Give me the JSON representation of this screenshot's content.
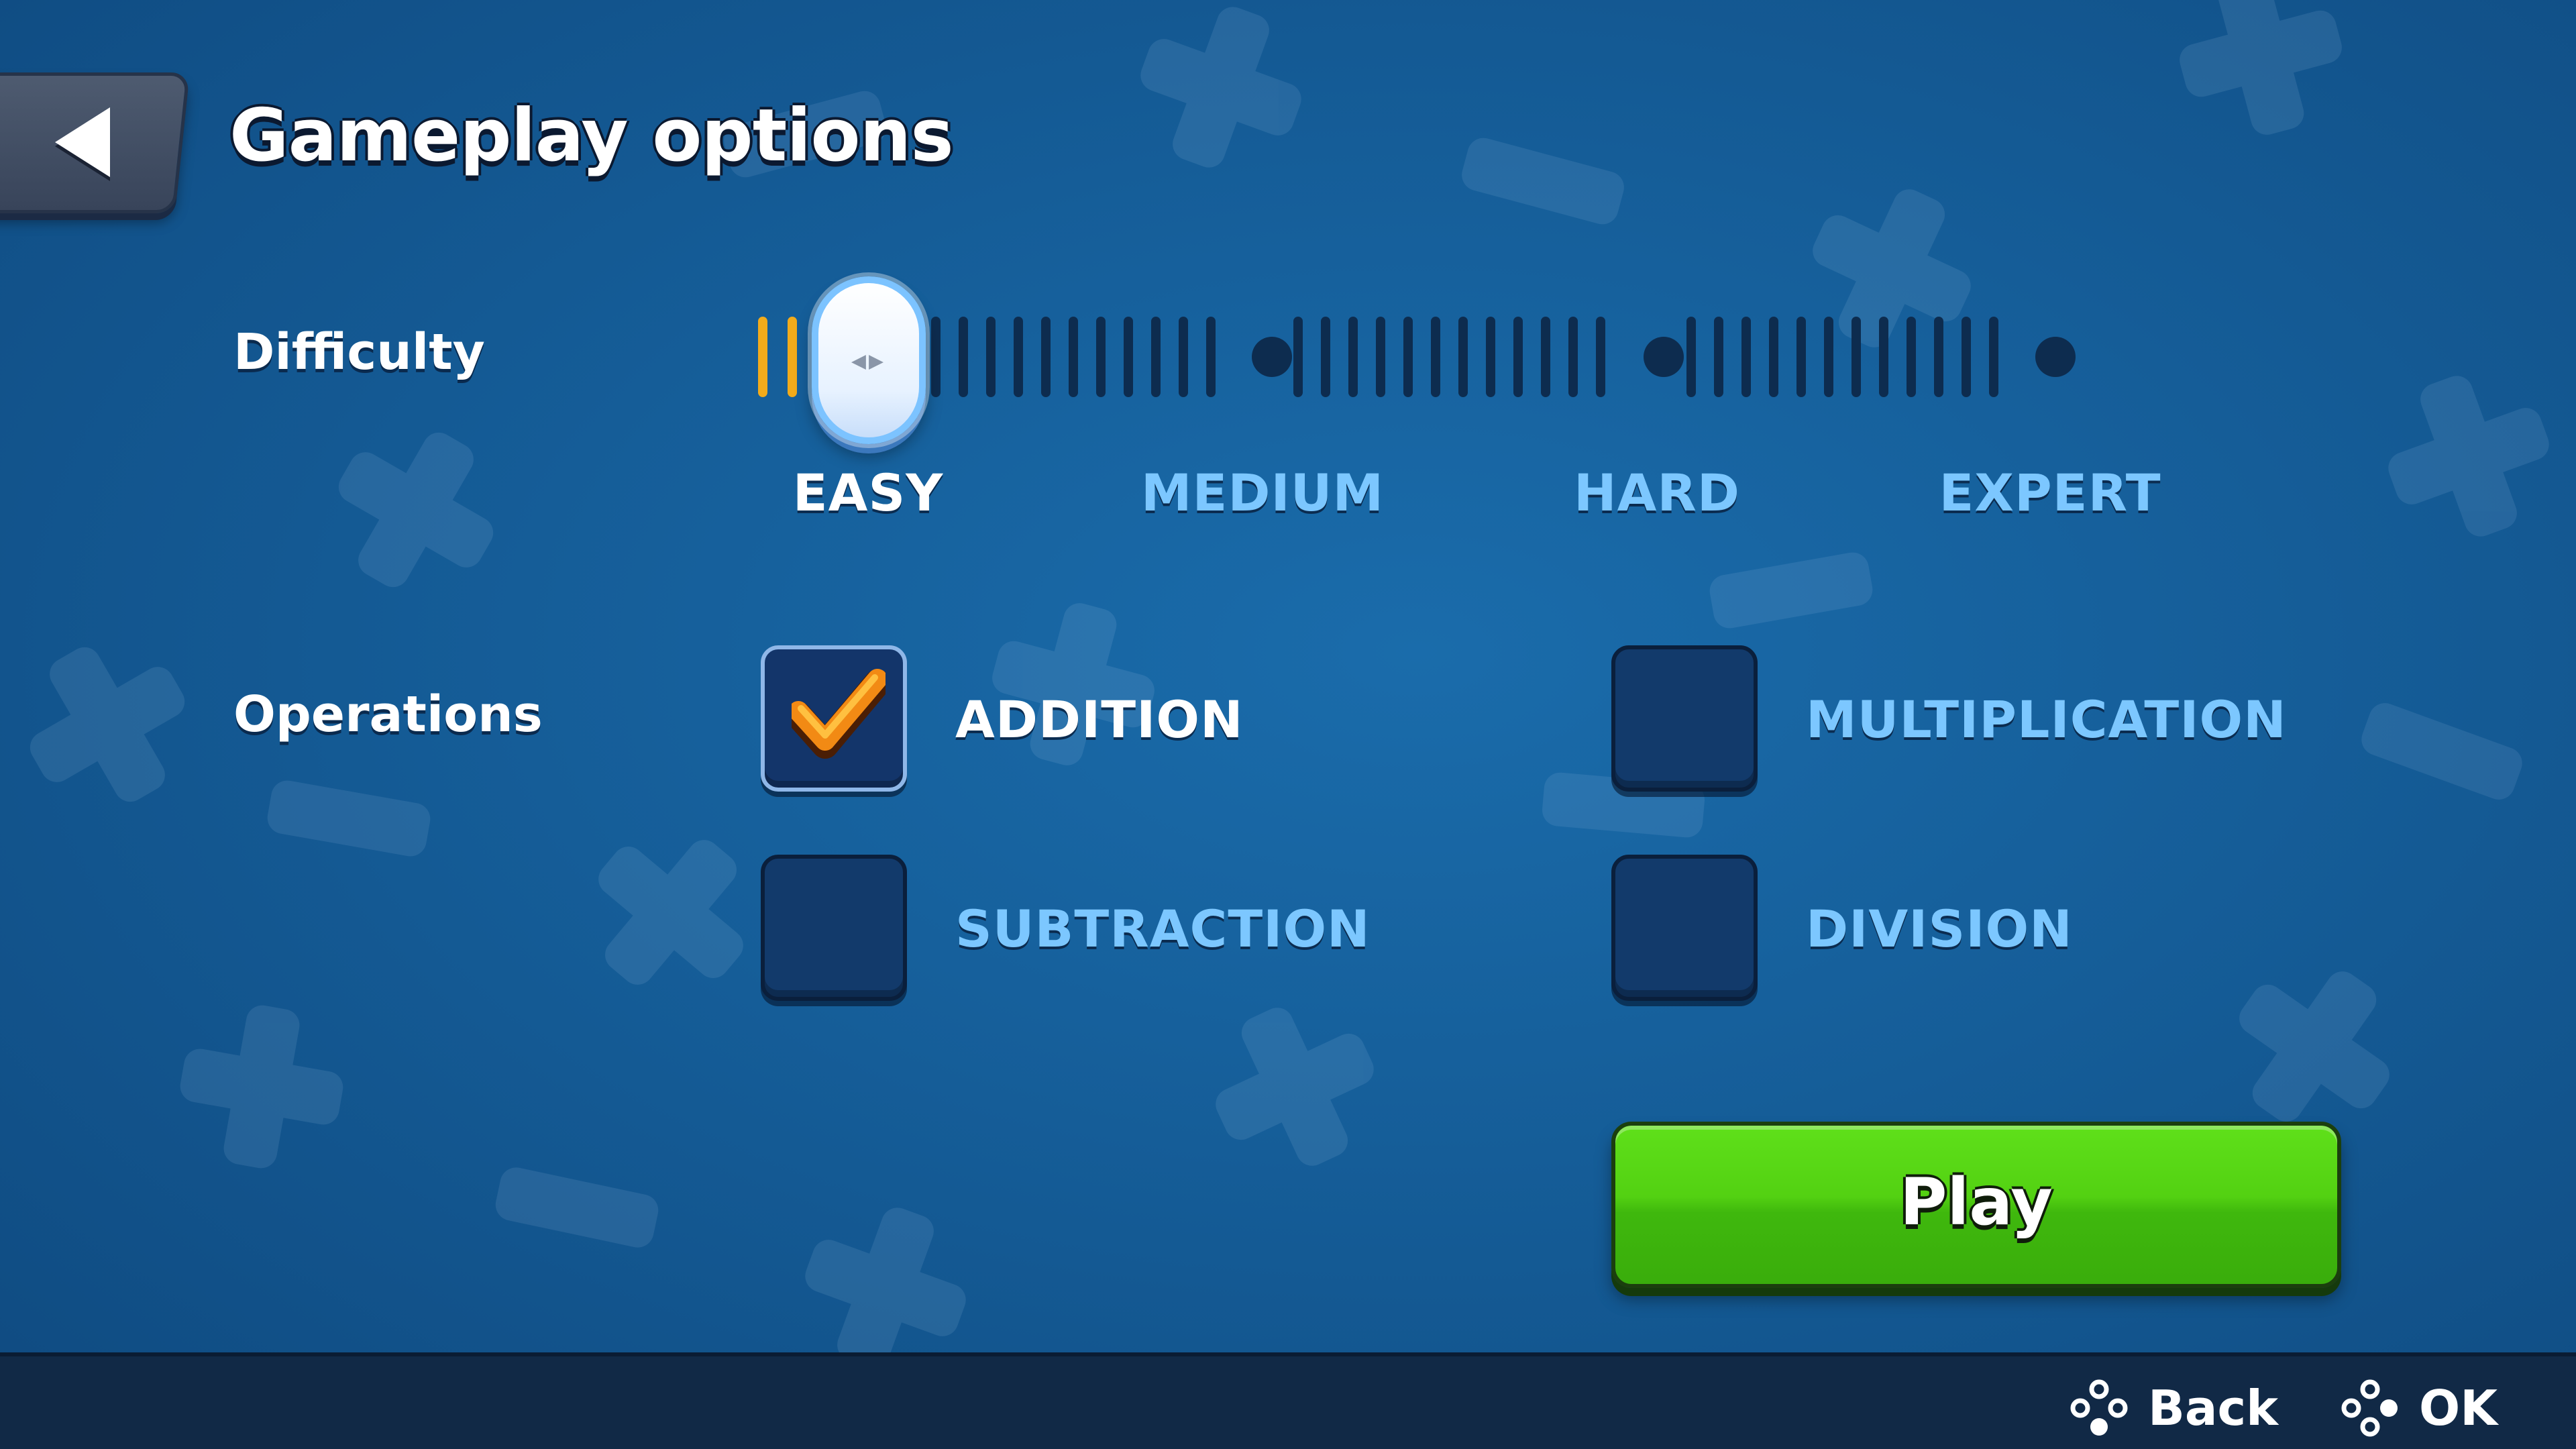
{
  "header": {
    "title": "Gameplay options",
    "back_icon": "back-arrow-icon"
  },
  "difficulty": {
    "label": "Difficulty",
    "levels": [
      "EASY",
      "MEDIUM",
      "HARD",
      "EXPERT"
    ],
    "selected": "EASY",
    "level_index": 0
  },
  "operations": {
    "label": "Operations",
    "items": [
      {
        "label": "ADDITION",
        "checked": true
      },
      {
        "label": "MULTIPLICATION",
        "checked": false
      },
      {
        "label": "SUBTRACTION",
        "checked": false
      },
      {
        "label": "DIVISION",
        "checked": false
      }
    ]
  },
  "play": {
    "label": "Play"
  },
  "footer": {
    "back_label": "Back",
    "ok_label": "OK",
    "icon": "gamepad-buttons-icon"
  },
  "colors": {
    "background": "#155d98",
    "accent_orange": "#f2ab1b",
    "play_green": "#53d112",
    "inactive_text": "#7cc7ff"
  }
}
